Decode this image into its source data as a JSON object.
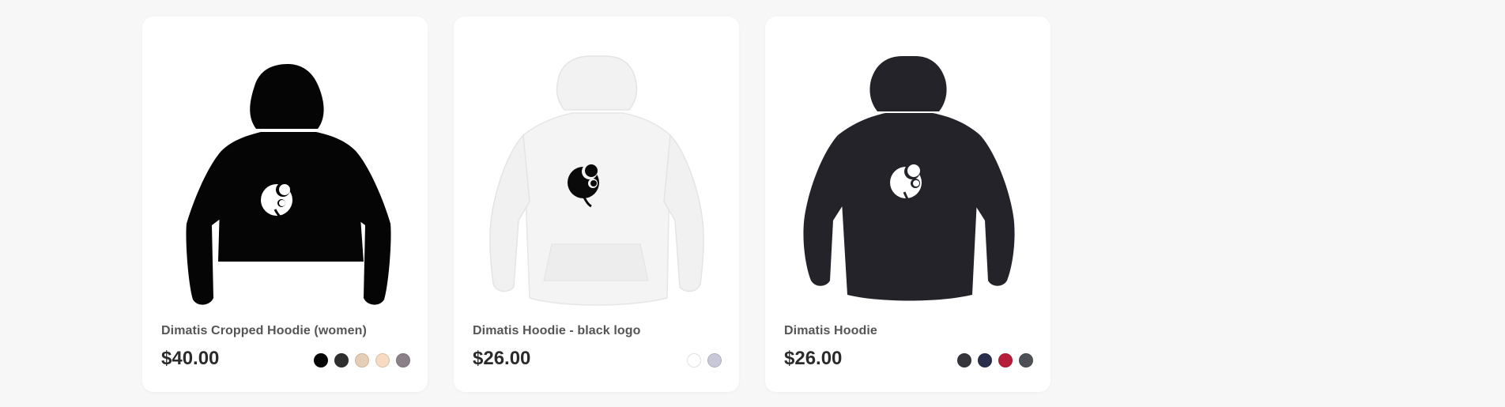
{
  "products": [
    {
      "title": "Dimatis Cropped Hoodie (women)",
      "price": "$40.00",
      "image_icon": "cropped-hoodie-black-icon",
      "garment_color": "#050505",
      "logo_color": "#ffffff",
      "swatches": [
        "#050505",
        "#2e2e2e",
        "#e6cdb6",
        "#f7dcc3",
        "#8b8088"
      ]
    },
    {
      "title": "Dimatis Hoodie - black logo",
      "price": "$26.00",
      "image_icon": "hoodie-white-icon",
      "garment_color": "#f4f4f4",
      "logo_color": "#0a0a0a",
      "swatches": [
        "#ffffff",
        "#c9c8d8"
      ]
    },
    {
      "title": "Dimatis Hoodie",
      "price": "$26.00",
      "image_icon": "hoodie-black-icon",
      "garment_color": "#25232a",
      "logo_color": "#ffffff",
      "swatches": [
        "#35353b",
        "#2a2f4e",
        "#b71c3a",
        "#4f5057"
      ]
    }
  ]
}
